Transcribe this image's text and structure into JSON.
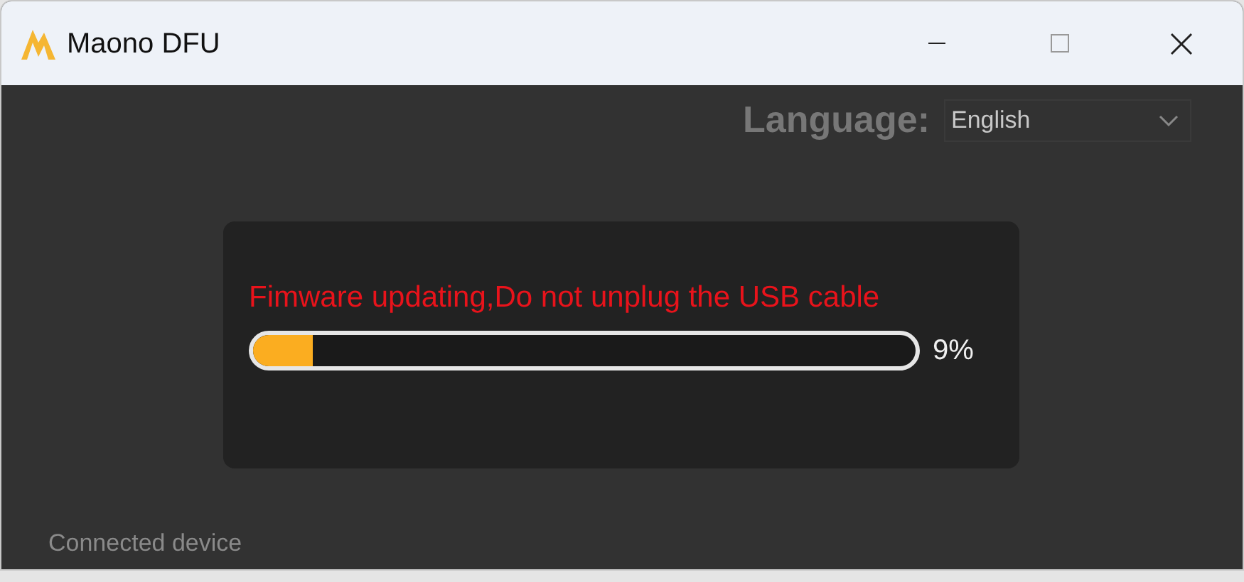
{
  "window": {
    "title": "Maono DFU"
  },
  "language": {
    "label": "Language:",
    "value": "English"
  },
  "update": {
    "message": "Fimware updating,Do not unplug the USB cable",
    "level": 0.09,
    "reading": "9%"
  },
  "status": {
    "text": "Connected device"
  }
}
